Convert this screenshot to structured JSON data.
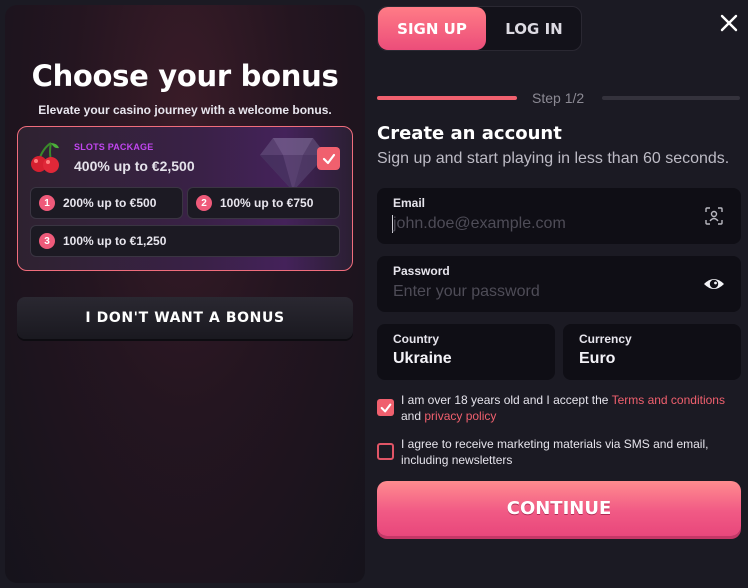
{
  "bonus": {
    "title": "Choose your bonus",
    "subtitle": "Elevate your casino journey with a welcome bonus.",
    "package": {
      "label": "SLOTS PACKAGE",
      "value": "400% up to €2,500",
      "selected": true
    },
    "options": [
      {
        "num": "1",
        "label": "200% up to €500"
      },
      {
        "num": "2",
        "label": "100% up to €750"
      },
      {
        "num": "3",
        "label": "100% up to €1,250"
      }
    ],
    "no_bonus_label": "I DON'T WANT A BONUS"
  },
  "tabs": {
    "signup": "SIGN UP",
    "login": "LOG IN",
    "active": "signup"
  },
  "step": {
    "label": "Step 1/2"
  },
  "form": {
    "title": "Create an account",
    "subtitle": "Sign up and start playing in less than 60 seconds.",
    "email": {
      "label": "Email",
      "placeholder": "john.doe@example.com"
    },
    "password": {
      "label": "Password",
      "placeholder": "Enter your password"
    },
    "country": {
      "label": "Country",
      "value": "Ukraine"
    },
    "currency": {
      "label": "Currency",
      "value": "Euro"
    },
    "terms": {
      "checked": true,
      "text_before": "I am over 18 years old and I accept the ",
      "terms_link": "Terms and conditions",
      "text_and": "and ",
      "privacy_link": "privacy policy"
    },
    "marketing": {
      "checked": false,
      "text": "I agree to receive marketing materials via SMS and email, including newsletters"
    },
    "continue_label": "CONTINUE"
  },
  "colors": {
    "accent": "#f0606e",
    "accent_pink": "#ec4d7a",
    "package_label": "#c146f0",
    "background": "#1b1a23"
  },
  "icons": [
    "cherry-icon",
    "gem-icon",
    "check-icon",
    "close-icon",
    "face-scan-icon",
    "eye-icon"
  ]
}
